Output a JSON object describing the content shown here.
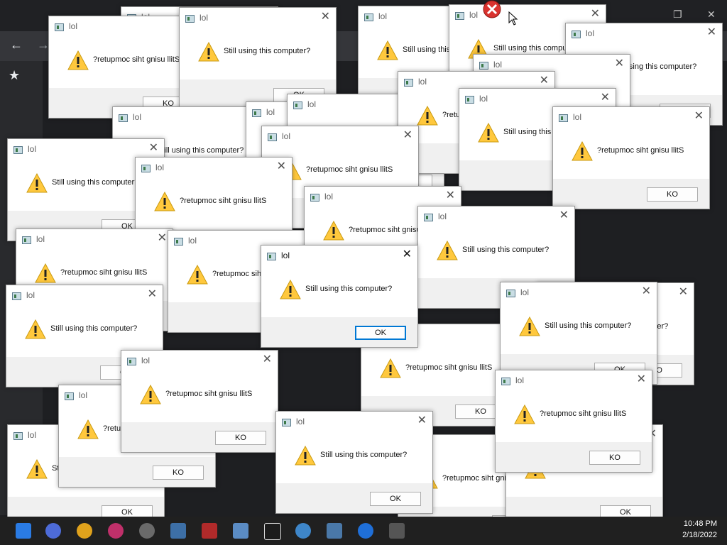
{
  "dialog_title": "lol",
  "message_normal": "Still using this computer?",
  "message_reversed": "?retupmoc siht gnisu llitS",
  "ok_label": "OK",
  "ko_label": "KO",
  "clock": {
    "time": "10:48 PM",
    "date": "2/18/2022"
  },
  "icons": {
    "warning": "warning-triangle-icon",
    "close": "close-icon",
    "app": "app-window-icon"
  },
  "colors": {
    "warning_fill": "#ffc83d",
    "focus_border": "#0078d4",
    "taskbar": "#202020"
  }
}
